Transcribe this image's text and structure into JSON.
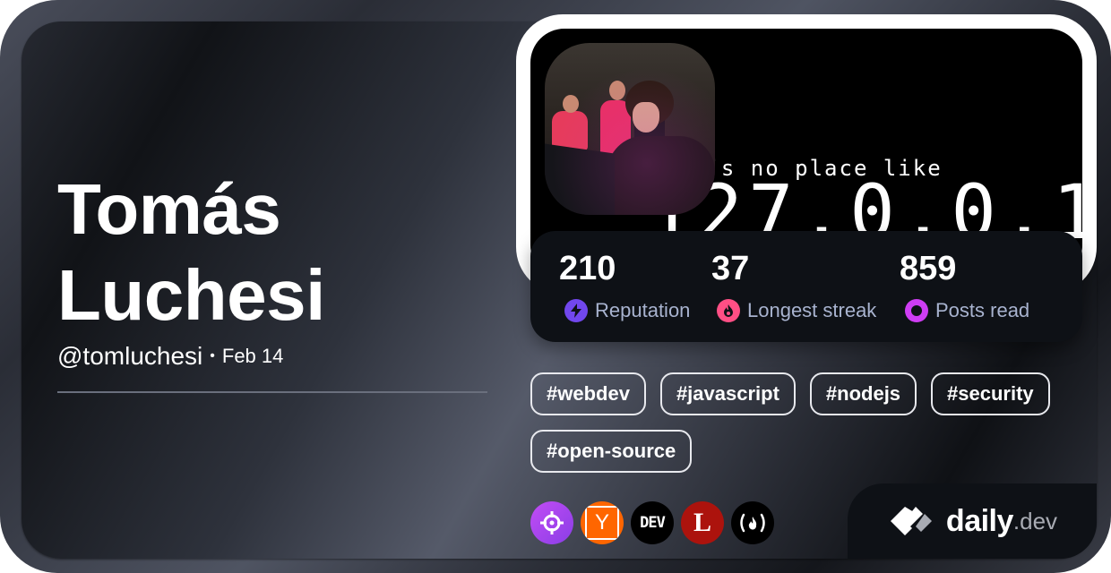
{
  "profile": {
    "name_line1": "Tomás",
    "name_line2": "Luchesi",
    "handle": "@tomluchesi",
    "separator": "•",
    "date": "Feb 14"
  },
  "cover": {
    "line1": "e’s no place like",
    "line2": "127.0.0.1"
  },
  "stats": [
    {
      "value": "210",
      "label": "Reputation",
      "icon": "lightning-icon",
      "color": "#7147ed"
    },
    {
      "value": "37",
      "label": "Longest streak",
      "icon": "flame-icon",
      "color": "#ff4f85"
    },
    {
      "value": "859",
      "label": "Posts read",
      "icon": "eye-icon",
      "color": "#ce3df3"
    }
  ],
  "tags": [
    "#webdev",
    "#javascript",
    "#nodejs",
    "#security",
    "#open-source"
  ],
  "sources": [
    {
      "name": "crosshair-source-icon",
      "bg": "#a24ef0"
    },
    {
      "name": "hacker-news-icon",
      "bg": "#ff6600",
      "glyph": "Y"
    },
    {
      "name": "dev-to-icon",
      "bg": "#000000",
      "glyph": "DEV"
    },
    {
      "name": "lobsters-icon",
      "bg": "#ac130d",
      "glyph": "L"
    },
    {
      "name": "freecodecamp-icon",
      "bg": "#000000",
      "glyph": "(🔥)"
    }
  ],
  "brand": {
    "word": "daily",
    "tld": ".dev"
  }
}
